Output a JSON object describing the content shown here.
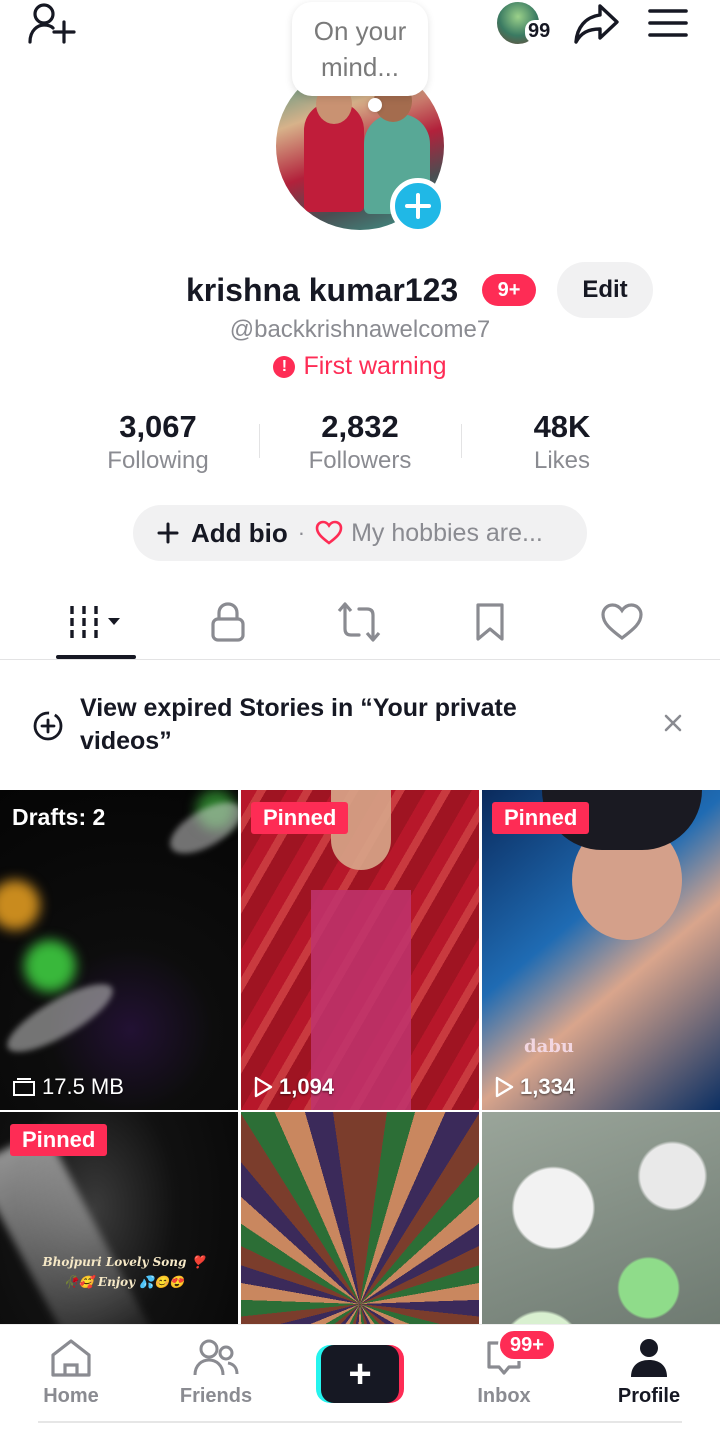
{
  "header": {
    "story_count": "99",
    "mind_bubble": "On your mind..."
  },
  "profile": {
    "username": "krishna kumar123",
    "name_badge": "9+",
    "edit_label": "Edit",
    "handle": "@backkrishnawelcome7",
    "warning": "First warning"
  },
  "stats": [
    {
      "value": "3,067",
      "label": "Following"
    },
    {
      "value": "2,832",
      "label": "Followers"
    },
    {
      "value": "48K",
      "label": "Likes"
    }
  ],
  "bio": {
    "add_label": "Add bio",
    "separator": "·",
    "hint": "My hobbies are..."
  },
  "tabs": [
    {
      "name": "videos-grid-icon",
      "active": true
    },
    {
      "name": "lock-icon"
    },
    {
      "name": "repost-icon"
    },
    {
      "name": "bookmark-icon"
    },
    {
      "name": "heart-icon"
    }
  ],
  "stories_notice": {
    "text": "View expired Stories in “Your private videos”"
  },
  "videos": [
    {
      "label": "Drafts: 2",
      "meta": "17.5 MB"
    },
    {
      "badge": "Pinned",
      "views": "1,094"
    },
    {
      "badge": "Pinned",
      "views": "1,334",
      "overlay": "dabu"
    },
    {
      "badge": "Pinned",
      "overlay": "Bhojpuri Lovely Song ❣️ 🥀🥰 Enjoy 💦😊😍"
    },
    {},
    {}
  ],
  "bottom_nav": {
    "home": "Home",
    "friends": "Friends",
    "create": "+",
    "inbox": "Inbox",
    "inbox_badge": "99+",
    "profile": "Profile"
  },
  "colors": {
    "accent": "#fe2c55",
    "cyan": "#25f4ee",
    "text": "#161823",
    "secondary": "#8a8b91"
  }
}
